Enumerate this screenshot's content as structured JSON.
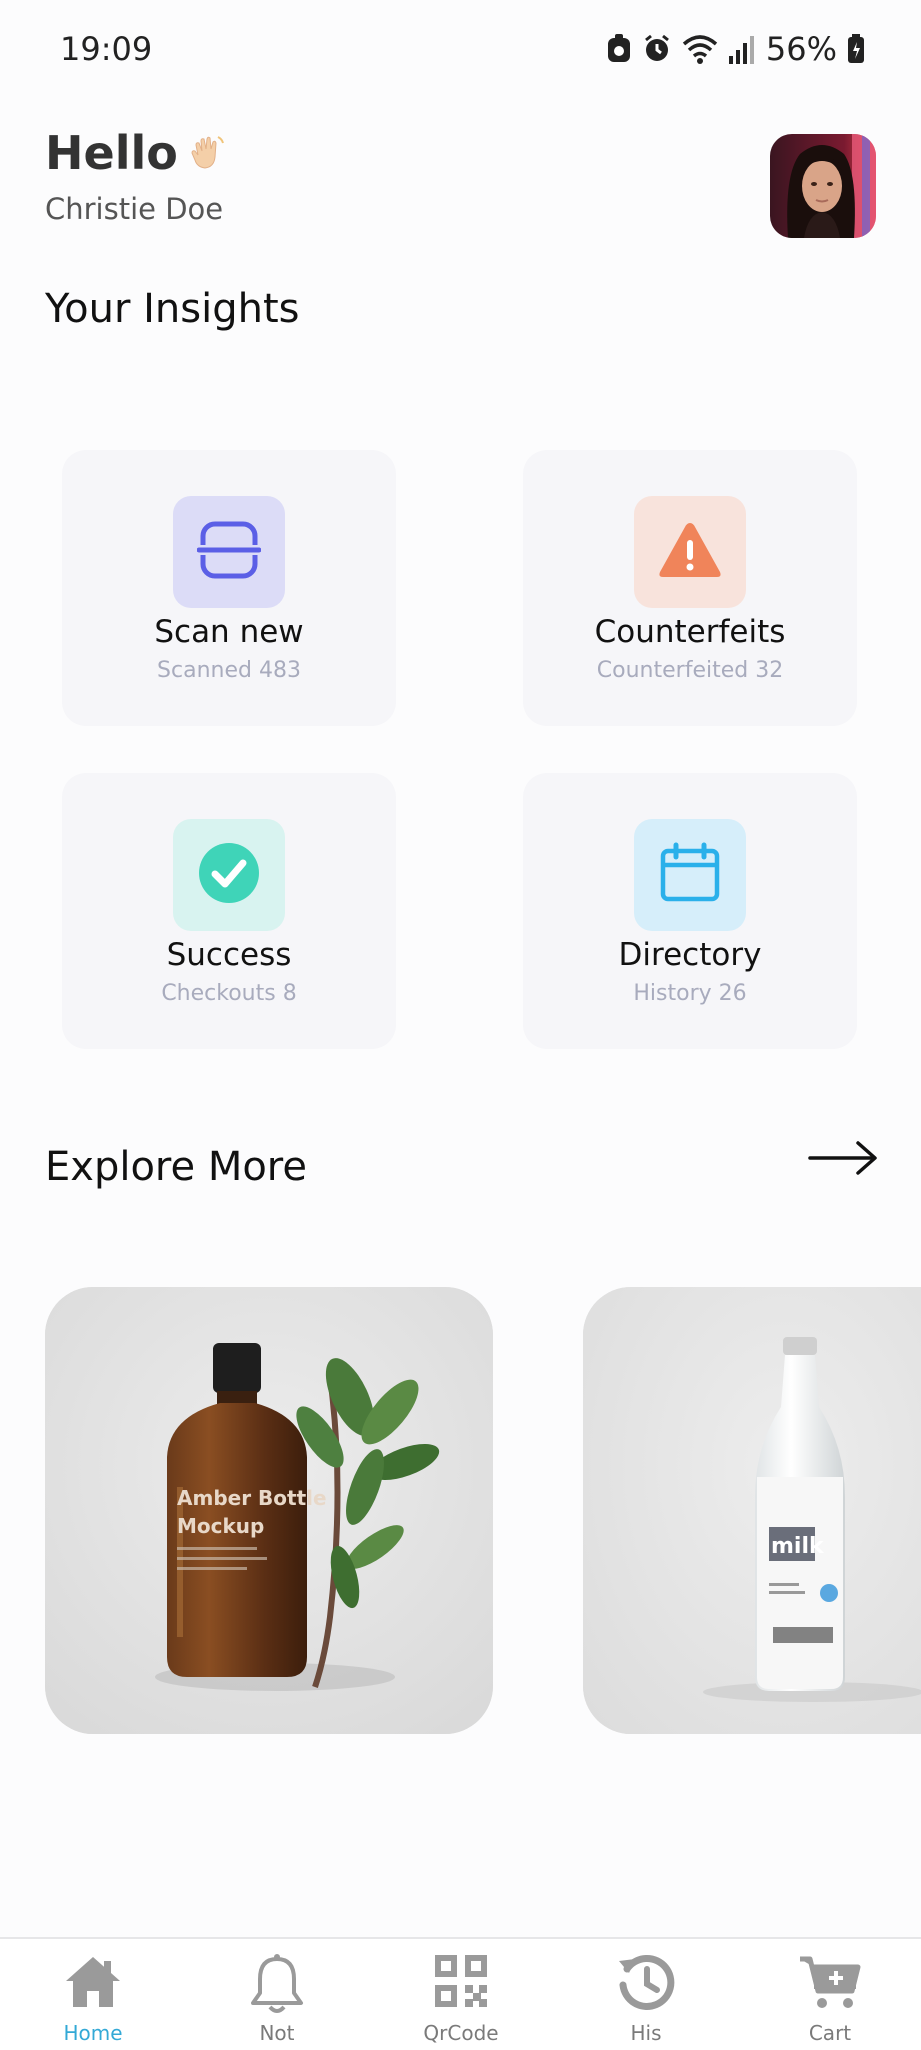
{
  "status_bar": {
    "time": "19:09",
    "battery": "56%",
    "icons": [
      "notification-icon",
      "alarm-icon",
      "wifi-icon",
      "signal-icon",
      "battery-icon"
    ]
  },
  "header": {
    "greeting": "Hello",
    "user_name": "Christie Doe"
  },
  "insights": {
    "title": "Your Insights",
    "cards": [
      {
        "title": "Scan new",
        "subtitle": "Scanned 483",
        "icon": "scan-icon",
        "icon_color": "#5b5fe6",
        "tile_color": "#dcdcf7"
      },
      {
        "title": "Counterfeits",
        "subtitle": "Counterfeited 32",
        "icon": "warning-icon",
        "icon_color": "#f0845a",
        "tile_color": "#f8e3dc"
      },
      {
        "title": "Success",
        "subtitle": "Checkouts 8",
        "icon": "check-circle-icon",
        "icon_color": "#3fd4b8",
        "tile_color": "#d8f3f0"
      },
      {
        "title": "Directory",
        "subtitle": "History 26",
        "icon": "calendar-icon",
        "icon_color": "#2ab0ea",
        "tile_color": "#d6eefa"
      }
    ]
  },
  "explore": {
    "title": "Explore More",
    "cards": [
      {
        "label": "amber-bottle-mockup-image",
        "bottle_text": [
          "Amber Bottle",
          "Mockup"
        ]
      },
      {
        "label": "milk-bottle-image",
        "bottle_text": [
          "milk"
        ]
      }
    ]
  },
  "bottom_nav": {
    "active_color": "#33a9d6",
    "items": [
      {
        "label": "Home",
        "icon": "home-icon",
        "active": true
      },
      {
        "label": "Not",
        "icon": "bell-icon",
        "active": false
      },
      {
        "label": "QrCode",
        "icon": "qrcode-icon",
        "active": false
      },
      {
        "label": "His",
        "icon": "history-icon",
        "active": false
      },
      {
        "label": "Cart",
        "icon": "cart-icon",
        "active": false
      }
    ]
  }
}
